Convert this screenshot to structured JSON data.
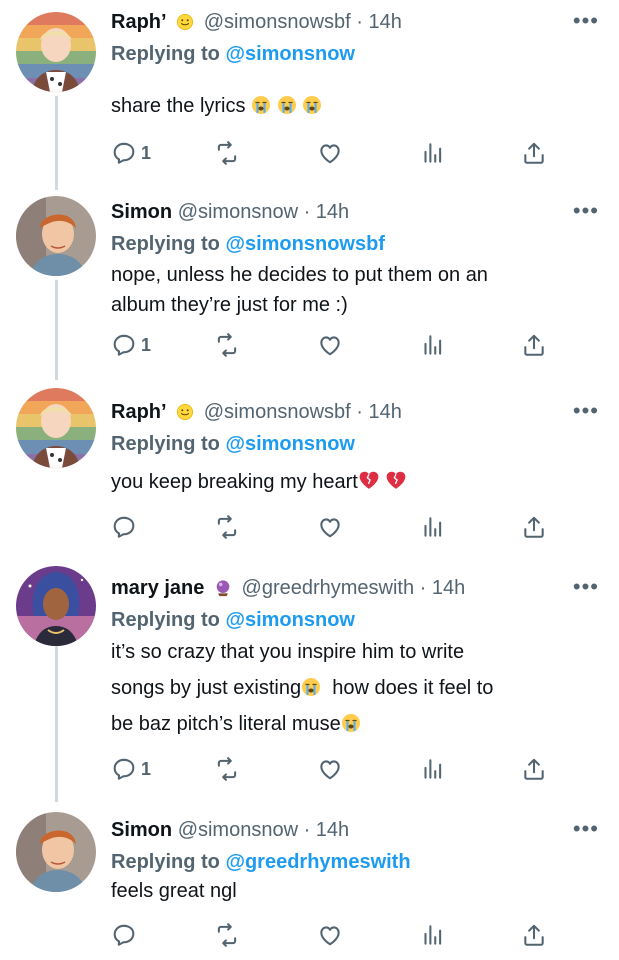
{
  "tweets": [
    {
      "name": "Raph’",
      "handle": "@simonsnowsbf",
      "time": "· 14h",
      "replying_prefix": "Replying to",
      "replying_to": "@simonsnow",
      "text": "share the lyrics",
      "reply_count": "1",
      "avatar": "raph-avatar",
      "badge": "smiley-emoji",
      "trailing_emojis": [
        "sob-emoji",
        "sob-emoji",
        "sob-emoji"
      ]
    },
    {
      "name": "Simon",
      "handle": "@simonsnow",
      "time": "· 14h",
      "replying_prefix": "Replying to",
      "replying_to": "@simonsnowsbf",
      "text_lines": [
        "nope, unless he decides to put them on an",
        "album they’re just for me :)"
      ],
      "reply_count": "1",
      "avatar": "simon-avatar"
    },
    {
      "name": "Raph’",
      "handle": "@simonsnowsbf",
      "time": "· 14h",
      "replying_prefix": "Replying to",
      "replying_to": "@simonsnow",
      "text": "you keep breaking my heart",
      "reply_count": "",
      "avatar": "raph-avatar",
      "badge": "smiley-emoji",
      "trailing_emojis": [
        "broken-heart-emoji",
        "broken-heart-emoji"
      ]
    },
    {
      "name": "mary jane",
      "handle": "@greedrhymeswith",
      "time": "· 14h",
      "replying_prefix": "Replying to",
      "replying_to": "@simonsnow",
      "text_lines": [
        "it’s so crazy that you inspire him to write",
        "songs by just existing",
        "  how does it feel to",
        "be baz pitch’s literal muse"
      ],
      "reply_count": "1",
      "avatar": "mary-jane-avatar",
      "badge": "crystal-ball-emoji"
    },
    {
      "name": "Simon",
      "handle": "@simonsnow",
      "time": "· 14h",
      "replying_prefix": "Replying to",
      "replying_to": "@greedrhymeswith",
      "text": "feels great ngl",
      "reply_count": "",
      "avatar": "simon-avatar"
    }
  ],
  "icons": {
    "more": "more-icon",
    "reply": "reply-icon",
    "retweet": "retweet-icon",
    "like": "like-icon",
    "views": "views-icon",
    "share": "share-icon"
  },
  "colors": {
    "link": "#1d9bf0",
    "secondary": "#536471",
    "text": "#0f1419",
    "thread_line": "#cfd9de"
  }
}
